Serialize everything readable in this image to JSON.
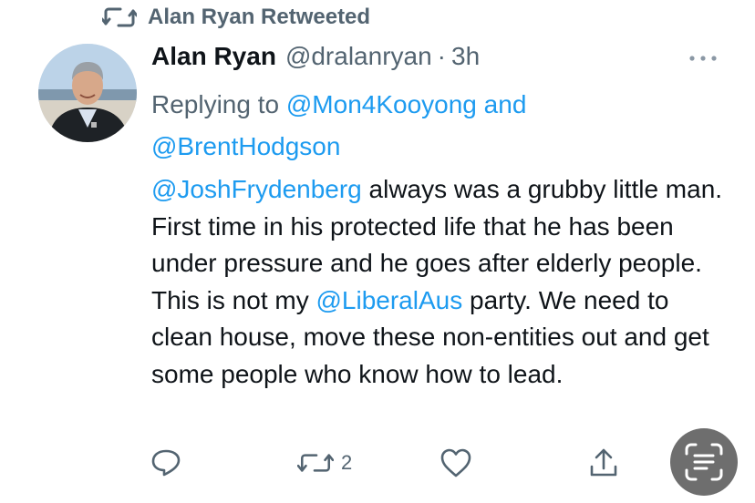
{
  "context": {
    "retweeted_label": "Alan Ryan Retweeted",
    "icon": "retweet-icon"
  },
  "tweet": {
    "author_name": "Alan Ryan",
    "handle": "@dralanryan",
    "separator": "·",
    "time": "3h",
    "replying_prefix": "Replying to",
    "reply_mention_1": "@Mon4Kooyong",
    "reply_and": "and",
    "reply_mention_2": "@BrentHodgson",
    "text_mention_1": "@JoshFrydenberg",
    "text_part_1": "always was a grubby little man. First time in his protected life that he has been under pressure and he goes after elderly people. This is not my",
    "text_mention_2": "@LiberalAus",
    "text_part_2": "party. We need to clean house, move these non-entities out and get some people who know how to lead."
  },
  "actions": {
    "reply_icon": "reply-icon",
    "retweet_icon": "retweet-icon",
    "retweet_count": "2",
    "like_icon": "heart-icon",
    "share_icon": "share-icon"
  },
  "overlay": {
    "scan_button_icon": "text-scan-icon"
  },
  "colors": {
    "link": "#1d9bf0",
    "secondary": "#536471",
    "primary": "#0f1419"
  }
}
